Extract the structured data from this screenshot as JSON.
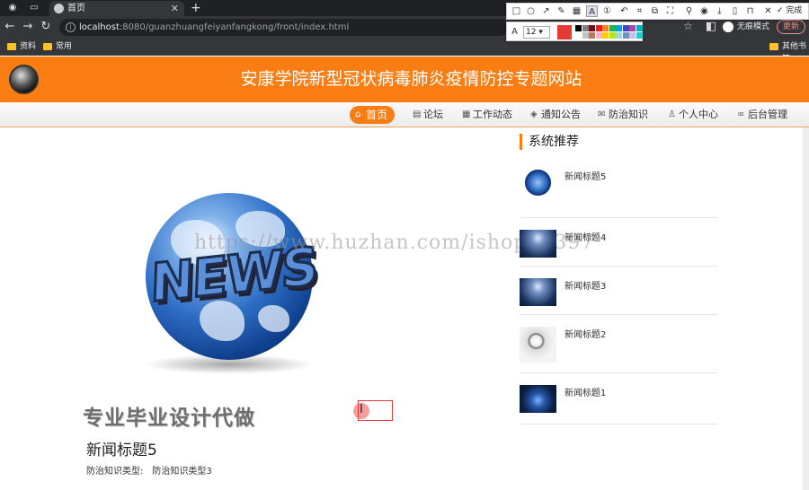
{
  "browser": {
    "tab_title": "首页",
    "url_host": "localhost",
    "url_rest": ":8080/guanzhuangfeiyanfangkong/front/index.html",
    "profile_label": "无痕模式",
    "update_label": "更新",
    "bookmarks": [
      "资料",
      "常用",
      "其他书签"
    ]
  },
  "screenshot_tool": {
    "done_label": "完成",
    "font_size": "12",
    "current_color": "#e53935",
    "swatches": [
      "#000000",
      "#7f7f7f",
      "#880015",
      "#ed1c24",
      "#ff7f27",
      "#22b14c",
      "#00a2e8",
      "#3f48cc",
      "#a349a4",
      "#00b3b3",
      "#ffffff",
      "#c3c3c3",
      "#b97a57",
      "#ffaec9",
      "#ffc90e",
      "#b5e61d",
      "#99d9ea",
      "#7092be",
      "#c8bfe7",
      "#22cccc"
    ]
  },
  "site": {
    "title": "安康学院新型冠状病毒肺炎疫情防控专题网站",
    "brand_color": "#f97d12"
  },
  "nav": {
    "home": "首页",
    "forum": "论坛",
    "work": "工作动态",
    "notice": "通知公告",
    "knowledge": "防治知识",
    "profile": "个人中心",
    "admin": "后台管理"
  },
  "main": {
    "image_text": "NEWS",
    "promo_watermark": "专业毕业设计代做",
    "url_watermark": "https://www.huzhan.com/ishop39397",
    "news_title": "新闻标题5",
    "meta_label": "防治知识类型:",
    "meta_value": "防治知识类型3"
  },
  "sidebar": {
    "heading": "系统推荐",
    "items": [
      {
        "title": "新闻标题5",
        "thumb": "globe-thumb"
      },
      {
        "title": "新闻标题4",
        "thumb": "stage-thumb"
      },
      {
        "title": "新闻标题3",
        "thumb": "stage-thumb"
      },
      {
        "title": "新闻标题2",
        "thumb": "magnifier-thumb"
      },
      {
        "title": "新闻标题1",
        "thumb": "dark-globe-thumb"
      }
    ]
  }
}
